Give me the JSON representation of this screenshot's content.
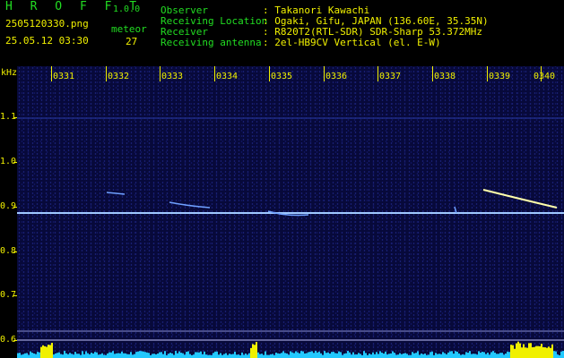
{
  "app": {
    "title": "H R O F F T",
    "version": "1.0.0"
  },
  "file": {
    "name": "2505120330.png",
    "datetime": "25.05.12 03:30"
  },
  "meteor": {
    "label": "meteor",
    "count": "27"
  },
  "info": [
    {
      "key": "Observer",
      "value": ": Takanori Kawachi"
    },
    {
      "key": "Receiving Location",
      "value": ": Ogaki, Gifu, JAPAN (136.60E, 35.35N)"
    },
    {
      "key": "Receiver",
      "value": ": R820T2(RTL-SDR) SDR-Sharp 53.372MHz"
    },
    {
      "key": "Receiving antenna",
      "value": ": 2el-HB9CV Vertical (el. E-W)"
    }
  ],
  "axis": {
    "y_unit": "kHz",
    "y_ticks": [
      "1.1",
      "1.0",
      "0.9",
      "0.8",
      "0.7",
      "0.6"
    ],
    "x_ticks": [
      "0331",
      "0332",
      "0333",
      "0334",
      "0335",
      "0336",
      "0337",
      "0338",
      "0339",
      "0340"
    ]
  },
  "colors": {
    "label": "#22dd22",
    "value": "#f0f000",
    "background": "#07093a",
    "signal": "#9fc8ff",
    "meteor": "#ffffaa"
  }
}
